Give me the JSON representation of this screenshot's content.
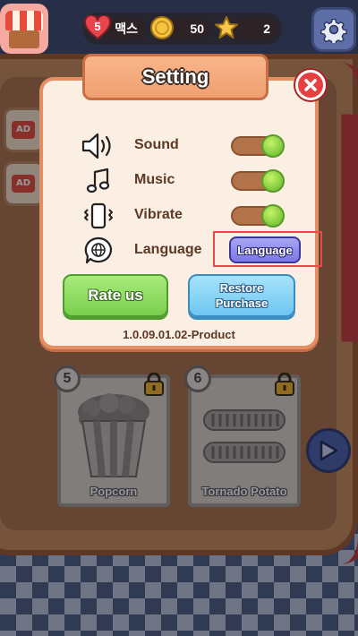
{
  "hud": {
    "lives_count": "5",
    "lives_label": "맥스",
    "coins": "50",
    "stars": "2"
  },
  "recipes": [
    {
      "number": "5",
      "name": "Popcorn",
      "locked": true
    },
    {
      "number": "6",
      "name": "Tornado Potato",
      "locked": true
    }
  ],
  "dialog": {
    "title": "Setting",
    "settings": [
      {
        "label": "Sound",
        "icon": "speaker-icon",
        "enabled": true
      },
      {
        "label": "Music",
        "icon": "music-note-icon",
        "enabled": true
      },
      {
        "label": "Vibrate",
        "icon": "phone-vibrate-icon",
        "enabled": true
      },
      {
        "label": "Language",
        "icon": "globe-chat-icon"
      }
    ],
    "language_button": "Language",
    "rate_button": "Rate us",
    "restore_button": "Restore Purchase",
    "version": "1.0.09.01.02-Product"
  },
  "colors": {
    "dialog_bg": "#fbeee2",
    "dialog_border": "#e48f63",
    "toggle_on": "#7bc93a",
    "rate_button": "#79cf4e",
    "restore_button": "#6ec6f2",
    "language_button": "#7c78e6",
    "highlight": "#e84848"
  }
}
